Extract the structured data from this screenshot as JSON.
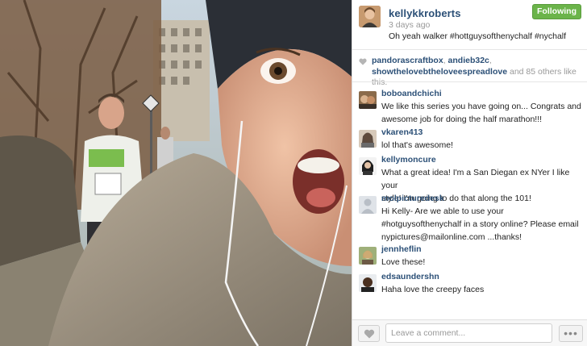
{
  "photo": {
    "alt_icon": "selfie-photo"
  },
  "post": {
    "username": "kellykkroberts",
    "time": "3 days ago",
    "caption": "Oh yeah walker #hottguysofthenychalf #nychalf",
    "follow_label": "Following"
  },
  "likes": {
    "user1": "pandorascraftbox",
    "sep1": ", ",
    "user2": "andieb32c",
    "sep2": ",",
    "user3": "showthelovebtheloveespreadlove",
    "and_text": " and ",
    "count": "85",
    "suffix": " others like this.",
    "icon": "heart-icon"
  },
  "comments": [
    {
      "user": "boboandchichi",
      "line1": "We like this series you have going on... Congrats and",
      "line2": "awesome job for doing the half marathon!!!",
      "line3": ""
    },
    {
      "user": "vkaren413",
      "line1": "lol that's awesome!",
      "line2": "",
      "line3": ""
    },
    {
      "user": "kellymoncure",
      "line1": "What a great idea! I'm a San Diegan ex NYer I like your",
      "line2": "style! I'm going to do that along the 101!",
      "line3": ""
    },
    {
      "user": "molpicturedesk",
      "line1": "Hi Kelly- Are we able to use your",
      "line2": "#hotguysofthenychalf in a story online? Please email",
      "line3": "nypictures@mailonline.com ...thanks!"
    },
    {
      "user": "jennheflin",
      "line1": "Love these!",
      "line2": "",
      "line3": ""
    },
    {
      "user": "edsaundershn",
      "line1": "Haha love the creepy faces",
      "line2": "",
      "line3": ""
    }
  ],
  "footer": {
    "comment_placeholder": "Leave a comment...",
    "more_label": "•••"
  },
  "colors": {
    "link": "#2c5077",
    "following_green": "#6bb44a",
    "meta_grey": "#999999"
  }
}
